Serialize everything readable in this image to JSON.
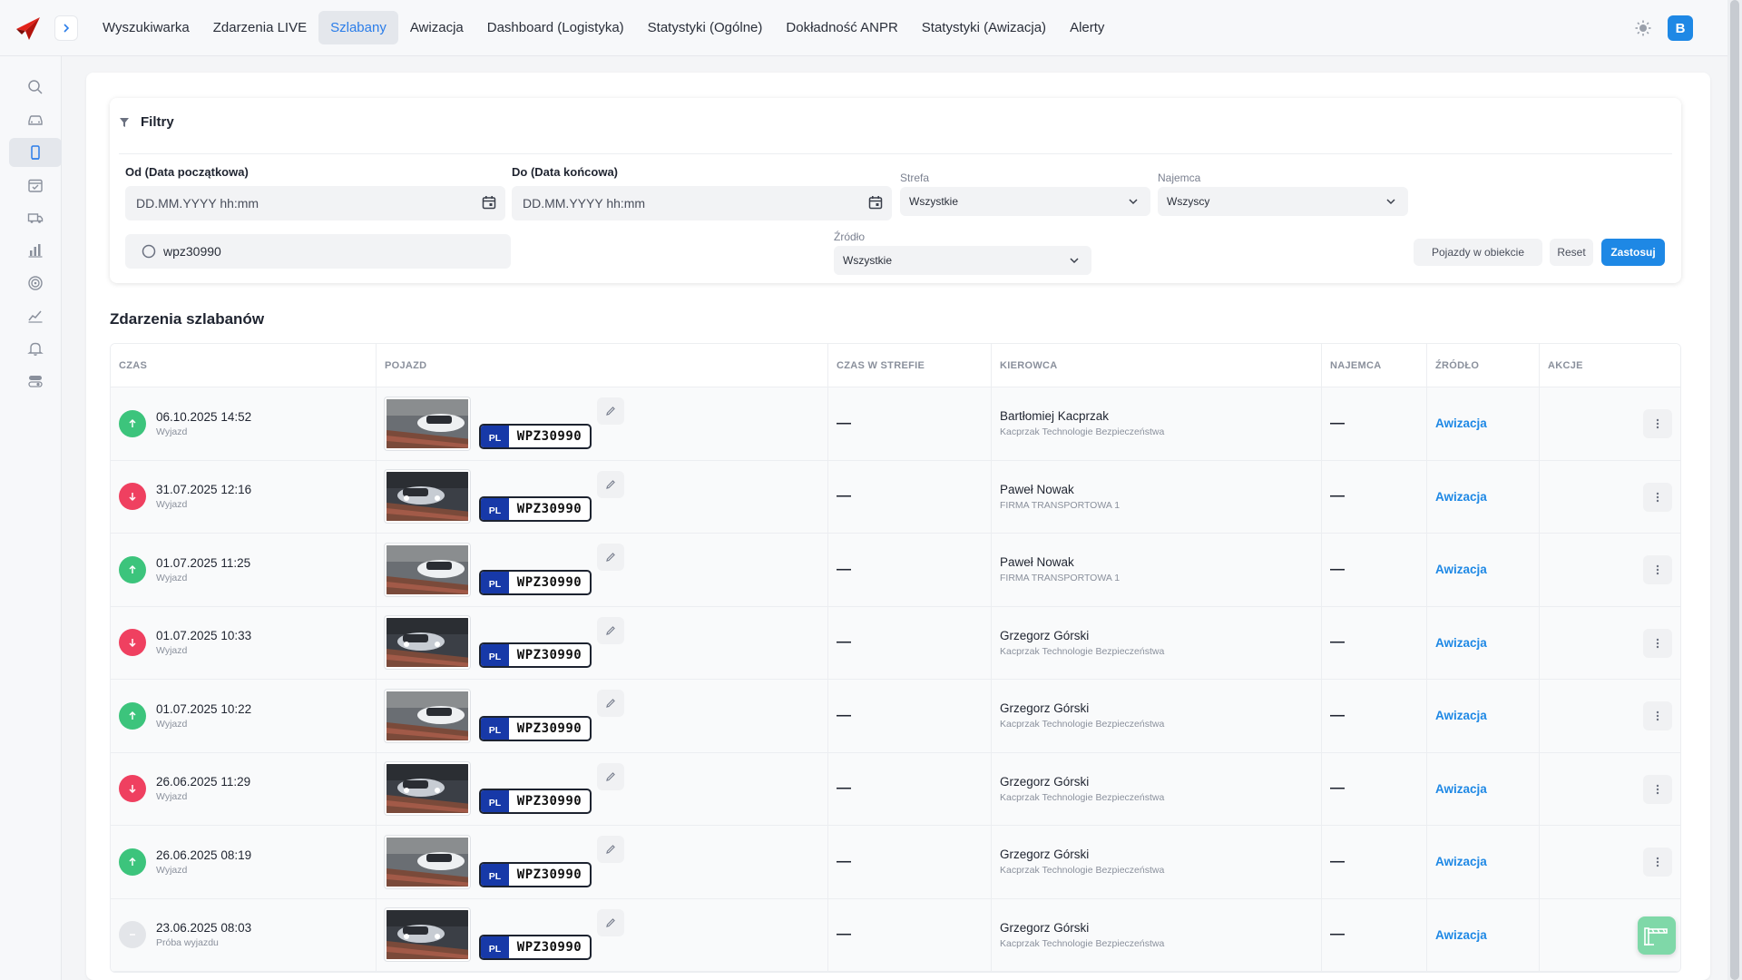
{
  "topbar": {
    "nav": [
      {
        "label": "Wyszukiwarka",
        "active": false
      },
      {
        "label": "Zdarzenia LIVE",
        "active": false
      },
      {
        "label": "Szlabany",
        "active": true
      },
      {
        "label": "Awizacja",
        "active": false
      },
      {
        "label": "Dashboard (Logistyka)",
        "active": false
      },
      {
        "label": "Statystyki (Ogólne)",
        "active": false
      },
      {
        "label": "Dokładność ANPR",
        "active": false
      },
      {
        "label": "Statystyki (Awizacja)",
        "active": false
      },
      {
        "label": "Alerty",
        "active": false
      }
    ],
    "avatar_initial": "B",
    "accent": "#1e88e5",
    "logo_color": "#e2231a"
  },
  "sidebar": {
    "items": [
      {
        "icon": "search-icon",
        "active": false
      },
      {
        "icon": "car-icon",
        "active": false
      },
      {
        "icon": "barrier-icon",
        "active": true
      },
      {
        "icon": "calendar-check-icon",
        "active": false
      },
      {
        "icon": "truck-icon",
        "active": false
      },
      {
        "icon": "bar-chart-icon",
        "active": false
      },
      {
        "icon": "target-icon",
        "active": false
      },
      {
        "icon": "line-chart-icon",
        "active": false
      },
      {
        "icon": "bell-icon",
        "active": false
      },
      {
        "icon": "toggle-icon",
        "active": false
      }
    ]
  },
  "filters": {
    "title": "Filtry",
    "from_label": "Od (Data początkowa)",
    "from_placeholder": "DD.MM.YYYY hh:mm",
    "to_label": "Do (Data końcowa)",
    "to_placeholder": "DD.MM.YYYY hh:mm",
    "zone_label": "Strefa",
    "zone_value": "Wszystkie",
    "tenant_label": "Najemca",
    "tenant_value": "Wszyscy",
    "source_label": "Źródło",
    "source_value": "Wszystkie",
    "search_value": "wpz30990",
    "btn_on_site": "Pojazdy w obiekcie",
    "btn_reset": "Reset",
    "btn_apply": "Zastosuj"
  },
  "events": {
    "title": "Zdarzenia szlabanów",
    "columns": [
      "CZAS",
      "POJAZD",
      "CZAS W STREFIE",
      "KIEROWCA",
      "NAJEMCA",
      "ŹRÓDŁO",
      "AKCJE"
    ],
    "rows": [
      {
        "direction": "up",
        "color": "#3cc47c",
        "datetime": "06.10.2025 14:52",
        "type": "Wyjazd",
        "country": "PL",
        "plate": "WPZ30990",
        "zone_time": "—",
        "driver": "Bartłomiej Kacprzak",
        "company": "Kacprzak Technologie Bezpieczeństwa",
        "tenant": "—",
        "source": "Awizacja"
      },
      {
        "direction": "down",
        "color": "#ef4060",
        "datetime": "31.07.2025 12:16",
        "type": "Wyjazd",
        "country": "PL",
        "plate": "WPZ30990",
        "zone_time": "—",
        "driver": "Paweł Nowak",
        "company": "FIRMA TRANSPORTOWA 1",
        "tenant": "—",
        "source": "Awizacja"
      },
      {
        "direction": "up",
        "color": "#3cc47c",
        "datetime": "01.07.2025 11:25",
        "type": "Wyjazd",
        "country": "PL",
        "plate": "WPZ30990",
        "zone_time": "—",
        "driver": "Paweł Nowak",
        "company": "FIRMA TRANSPORTOWA 1",
        "tenant": "—",
        "source": "Awizacja"
      },
      {
        "direction": "down",
        "color": "#ef4060",
        "datetime": "01.07.2025 10:33",
        "type": "Wyjazd",
        "country": "PL",
        "plate": "WPZ30990",
        "zone_time": "—",
        "driver": "Grzegorz Górski",
        "company": "Kacprzak Technologie Bezpieczeństwa",
        "tenant": "—",
        "source": "Awizacja"
      },
      {
        "direction": "up",
        "color": "#3cc47c",
        "datetime": "01.07.2025 10:22",
        "type": "Wyjazd",
        "country": "PL",
        "plate": "WPZ30990",
        "zone_time": "—",
        "driver": "Grzegorz Górski",
        "company": "Kacprzak Technologie Bezpieczeństwa",
        "tenant": "—",
        "source": "Awizacja"
      },
      {
        "direction": "down",
        "color": "#ef4060",
        "datetime": "26.06.2025 11:29",
        "type": "Wyjazd",
        "country": "PL",
        "plate": "WPZ30990",
        "zone_time": "—",
        "driver": "Grzegorz Górski",
        "company": "Kacprzak Technologie Bezpieczeństwa",
        "tenant": "—",
        "source": "Awizacja"
      },
      {
        "direction": "up",
        "color": "#3cc47c",
        "datetime": "26.06.2025 08:19",
        "type": "Wyjazd",
        "country": "PL",
        "plate": "WPZ30990",
        "zone_time": "—",
        "driver": "Grzegorz Górski",
        "company": "Kacprzak Technologie Bezpieczeństwa",
        "tenant": "—",
        "source": "Awizacja"
      },
      {
        "direction": "none",
        "color": "#e3e5e9",
        "datetime": "23.06.2025 08:03",
        "type": "Próba wyjazdu",
        "country": "PL",
        "plate": "WPZ30990",
        "zone_time": "—",
        "driver": "Grzegorz Górski",
        "company": "Kacprzak Technologie Bezpieczeństwa",
        "tenant": "—",
        "source": "Awizacja"
      }
    ]
  }
}
